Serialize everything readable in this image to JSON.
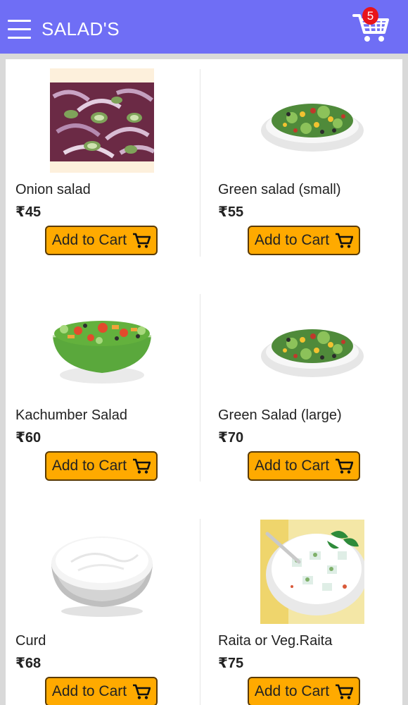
{
  "header": {
    "title": "SALAD'S",
    "cart_count": "5",
    "accent": "#6f6ef5",
    "badge_color": "#e8141b"
  },
  "products": [
    {
      "name": "Onion salad",
      "price": "₹45",
      "button": "Add to Cart"
    },
    {
      "name": "Green salad (small)",
      "price": "₹55",
      "button": "Add to Cart"
    },
    {
      "name": "Kachumber Salad",
      "price": "₹60",
      "button": "Add to Cart"
    },
    {
      "name": "Green Salad (large)",
      "price": "₹70",
      "button": "Add to Cart"
    },
    {
      "name": "Curd",
      "price": "₹68",
      "button": "Add to Cart"
    },
    {
      "name": "Raita or Veg.Raita",
      "price": "₹75",
      "button": "Add to Cart"
    }
  ],
  "button_color": "#ffaa00"
}
